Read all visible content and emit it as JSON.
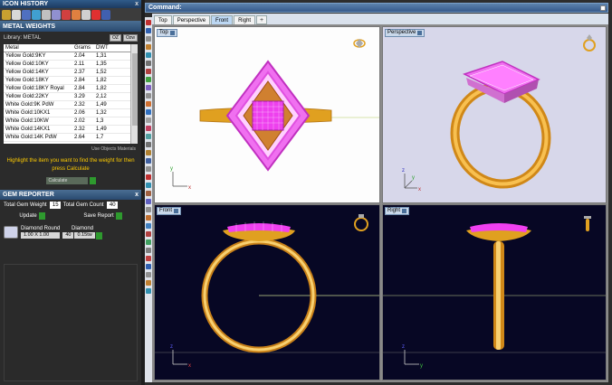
{
  "left_panel": {
    "icon_history_title": "ICON HISTORY",
    "close_glyph": "x",
    "metal_weights_title": "METAL WEIGHTS",
    "library_label": "Library: METAL",
    "lib_btn_1": "OZ",
    "lib_btn_2": "Ozw",
    "columns": [
      "Metal",
      "Grams",
      "DWT"
    ],
    "rows": [
      {
        "metal": "Yellow Gold:9KY",
        "grams": "2.04",
        "dwt": "1,31"
      },
      {
        "metal": "Yellow Gold:10KY",
        "grams": "2.11",
        "dwt": "1,35"
      },
      {
        "metal": "Yellow Gold:14KY",
        "grams": "2.37",
        "dwt": "1,52"
      },
      {
        "metal": "Yellow Gold:18KY",
        "grams": "2.84",
        "dwt": "1,82"
      },
      {
        "metal": "Yellow Gold:18KY Royal",
        "grams": "2.84",
        "dwt": "1,82"
      },
      {
        "metal": "Yellow Gold:22KY",
        "grams": "3.29",
        "dwt": "2,12"
      },
      {
        "metal": "White Gold:9K PdW",
        "grams": "2.32",
        "dwt": "1,49"
      },
      {
        "metal": "White Gold:10KX1",
        "grams": "2.06",
        "dwt": "1,32"
      },
      {
        "metal": "White Gold:10KW",
        "grams": "2.02",
        "dwt": "1,3"
      },
      {
        "metal": "White Gold:14KX1",
        "grams": "2.32",
        "dwt": "1,49"
      },
      {
        "metal": "White Gold:14K PdW",
        "grams": "2.64",
        "dwt": "1,7"
      }
    ],
    "use_objects_label": "Use Objects Materials",
    "hint_text": "Highlight the item you want to find the weight for then press Calculate",
    "calculate_label": "Calculate",
    "gem_reporter_title": "GEM REPORTER",
    "total_gem_weight_label": "Total Gem Weight",
    "total_gem_weight_value": "15",
    "total_gem_count_label": "Total Gem Count",
    "total_gem_count_value": "40",
    "update_label": "Update",
    "save_report_label": "Save Report",
    "gem": {
      "shape": "Diamond Round",
      "size": "1.00 X 1.00",
      "material": "Diamond",
      "count": "40",
      "weight": "0.15tw"
    }
  },
  "command_bar": {
    "label": "Command:"
  },
  "tabs": [
    "Top",
    "Perspective",
    "Front",
    "Right"
  ],
  "active_tab": "Front",
  "add_tab_glyph": "+",
  "viewports": {
    "top": "Top",
    "perspective": "Perspective",
    "front": "Front",
    "right": "Right"
  },
  "axis_labels": {
    "x": "x",
    "y": "y",
    "z": "z"
  },
  "colors": {
    "gold": "#e0a020",
    "gem_pink": "#ff40ff",
    "viewport_dark": "#070724",
    "viewport_light": "#fdfdfd",
    "header_blue": "#2f5b8a"
  }
}
